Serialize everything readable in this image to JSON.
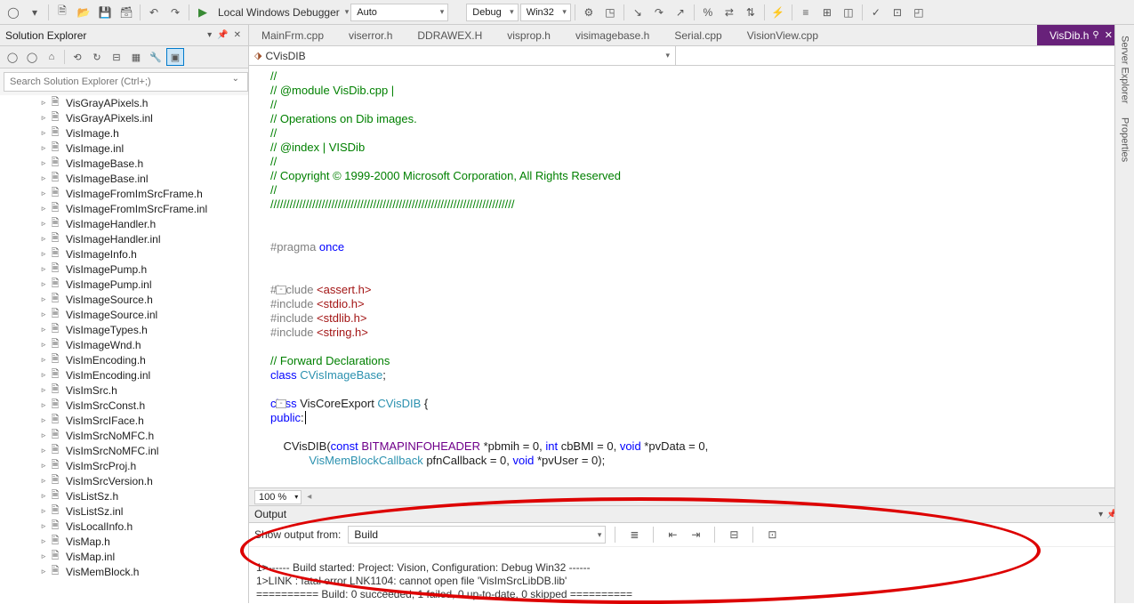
{
  "toolbar": {
    "debugger_label": "Local Windows Debugger",
    "dd_auto": "Auto",
    "dd_config": "Debug",
    "dd_platform": "Win32"
  },
  "solution_explorer": {
    "title": "Solution Explorer",
    "search_placeholder": "Search Solution Explorer (Ctrl+;)",
    "files": [
      "VisGrayAPixels.h",
      "VisGrayAPixels.inl",
      "VisImage.h",
      "VisImage.inl",
      "VisImageBase.h",
      "VisImageBase.inl",
      "VisImageFromImSrcFrame.h",
      "VisImageFromImSrcFrame.inl",
      "VisImageHandler.h",
      "VisImageHandler.inl",
      "VisImageInfo.h",
      "VisImagePump.h",
      "VisImagePump.inl",
      "VisImageSource.h",
      "VisImageSource.inl",
      "VisImageTypes.h",
      "VisImageWnd.h",
      "VisImEncoding.h",
      "VisImEncoding.inl",
      "VisImSrc.h",
      "VisImSrcConst.h",
      "VisImSrcIFace.h",
      "VisImSrcNoMFC.h",
      "VisImSrcNoMFC.inl",
      "VisImSrcProj.h",
      "VisImSrcVersion.h",
      "VisListSz.h",
      "VisListSz.inl",
      "VisLocalInfo.h",
      "VisMap.h",
      "VisMap.inl",
      "VisMemBlock.h"
    ]
  },
  "tabs": [
    {
      "label": "MainFrm.cpp"
    },
    {
      "label": "viserror.h"
    },
    {
      "label": "DDRAWEX.H"
    },
    {
      "label": "visprop.h"
    },
    {
      "label": "visimagebase.h"
    },
    {
      "label": "Serial.cpp"
    },
    {
      "label": "VisionView.cpp"
    }
  ],
  "active_tab": {
    "label": "VisDib.h"
  },
  "navbar": {
    "scope": "CVisDIB"
  },
  "zoom": "100 %",
  "code": {
    "l1": "//",
    "l2": "// @module VisDib.cpp |",
    "l3": "//",
    "l4": "// Operations on Dib images.",
    "l5": "//",
    "l6": "// @index | VISDib",
    "l7": "//",
    "l8": "// Copyright © 1999-2000 Microsoft Corporation, All Rights Reserved",
    "l9": "//",
    "l10": "////////////////////////////////////////////////////////////////////////////",
    "pragma": "#pragma",
    "once": " once",
    "include": "#include",
    "inc1": " <assert.h>",
    "inc2": " <stdio.h>",
    "inc3": " <stdlib.h>",
    "inc4": " <string.h>",
    "fwd": "// Forward Declarations",
    "class_kw": "class",
    "cvimgbase": " CVisImageBase",
    "viscore": " VisCoreExport ",
    "cvisdib": "CVisDIB",
    "brace": " {",
    "public": "public",
    "ctor_pre": "    CVisDIB(",
    "const_kw": "const",
    "bmih": " BITMAPINFOHEADER",
    "ctor_args1": " *pbmih = 0, ",
    "int_kw": "int",
    "ctor_args2": " cbBMI = 0, ",
    "void_kw": "void",
    "ctor_args3": " *pvData = 0,",
    "line2_pre": "            ",
    "vismem": "VisMemBlockCallback",
    "ctor_args4": " pfnCallback = 0, ",
    "ctor_args5": " *pvUser = 0);"
  },
  "output": {
    "title": "Output",
    "show_from": "Show output from:",
    "source": "Build",
    "line1": "1>------ Build started: Project: Vision, Configuration: Debug Win32 ------",
    "line2": "1>LINK : fatal error LNK1104: cannot open file 'VisImSrcLibDB.lib'",
    "line3": "========== Build: 0 succeeded, 1 failed, 0 up-to-date, 0 skipped =========="
  },
  "side_tabs": {
    "t1": "Server Explorer",
    "t2": "Properties"
  }
}
